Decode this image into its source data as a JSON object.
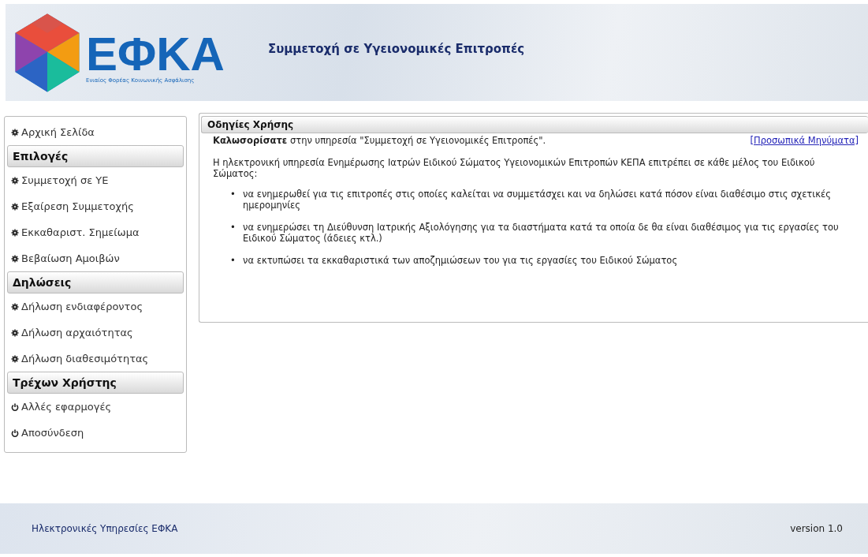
{
  "header": {
    "logo_text": "ΕΦΚΑ",
    "logo_subtitle": "Ενιαίος Φορέας Κοινωνικής Ασφάλισης",
    "title": "Συμμετοχή σε Υγειονομικές Επιτροπές"
  },
  "sidebar": {
    "items": [
      {
        "kind": "gear",
        "label": "Αρχική Σελίδα"
      },
      {
        "kind": "header",
        "label": "Επιλογές"
      },
      {
        "kind": "gear",
        "label": "Συμμετοχή σε ΥΕ"
      },
      {
        "kind": "gear",
        "label": "Εξαίρεση Συμμετοχής"
      },
      {
        "kind": "gear",
        "label": "Εκκαθαριστ. Σημείωμα"
      },
      {
        "kind": "gear",
        "label": "Βεβαίωση Αμοιβών"
      },
      {
        "kind": "header",
        "label": "Δηλώσεις"
      },
      {
        "kind": "gear",
        "label": "Δήλωση ενδιαφέροντος"
      },
      {
        "kind": "gear",
        "label": "Δήλωση αρχαιότητας"
      },
      {
        "kind": "gear",
        "label": "Δήλωση διαθεσιμότητας"
      },
      {
        "kind": "header",
        "label": "Τρέχων Χρήστης"
      },
      {
        "kind": "power",
        "label": "Αλλές εφαρμογές"
      },
      {
        "kind": "power",
        "label": "Αποσύνδεση"
      }
    ]
  },
  "panel": {
    "title": "Οδηγίες Χρήσης",
    "welcome": "**Καλωσορίσατε** στην υπηρεσία \"Συμμετοχή σε Υγειονομικές Επιτροπές\".",
    "messages_link": "[Προσωπικά Μηνύματα]",
    "intro": "Η ηλεκτρονική υπηρεσία Ενημέρωσης Ιατρών Ειδικού Σώματος Υγειονομικών Επιτροπών ΚΕΠΑ επιτρέπει σε κάθε μέλος του Ειδικού Σώματος:",
    "bullets": [
      {
        "marker": "•",
        "text": "να ενημερωθεί για τις επιτροπές στις οποίες καλείται να συμμετάσχει και να δηλώσει κατά πόσον είναι διαθέσιμο στις σχετικές ημερομηνίες"
      },
      {
        "marker": "•",
        "text": "να ενημερώσει τη Διεύθυνση Ιατρικής Αξιολόγησης για τα διαστήματα κατά τα οποία δε θα είναι διαθέσιμος για τις εργασίες του Ειδικού Σώματος (άδειες κτλ.)"
      },
      {
        "marker": "•",
        "text": "να εκτυπώσει τα εκκαθαριστικά των αποζημιώσεων του για τις εργασίες του Ειδικού Σώματος"
      }
    ]
  },
  "footer": {
    "left": "Ηλεκτρονικές Υπηρεσίες ΕΦΚΑ",
    "right": "version 1.0"
  }
}
